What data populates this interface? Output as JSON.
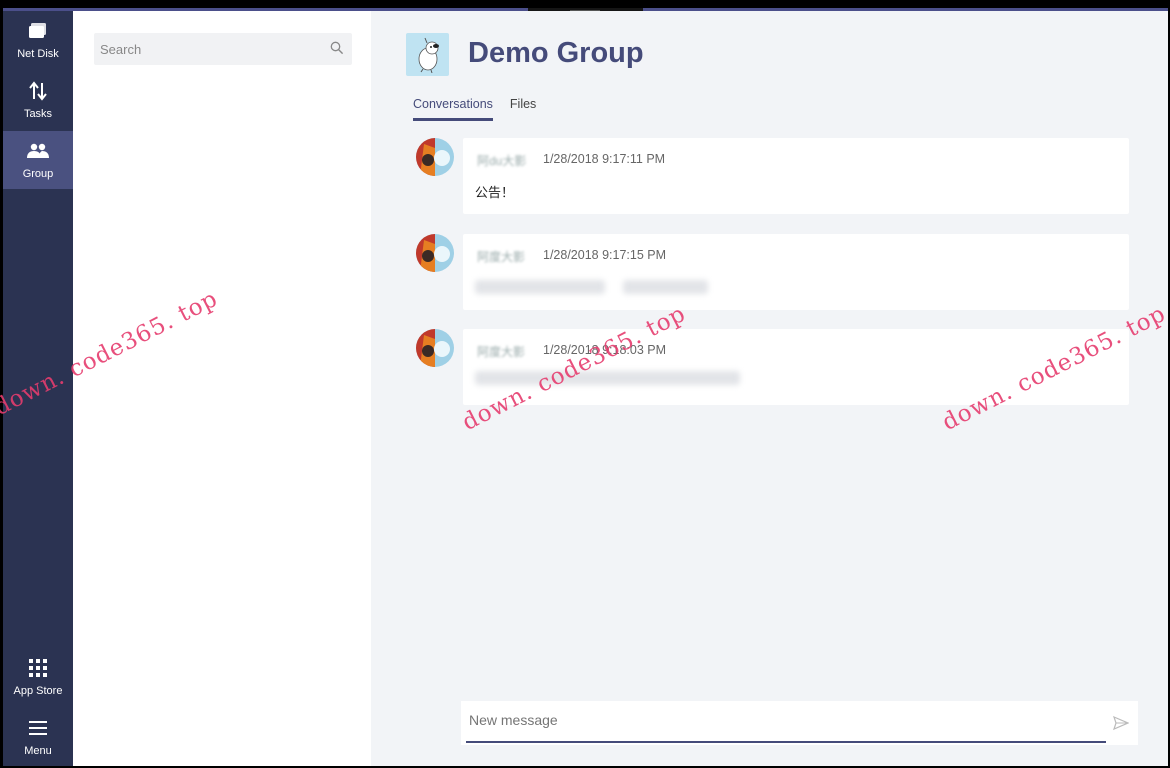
{
  "rail": {
    "items": [
      {
        "label": "Net Disk",
        "icon": "folder-icon"
      },
      {
        "label": "Tasks",
        "icon": "arrows-updown-icon"
      },
      {
        "label": "Group",
        "icon": "people-icon",
        "active": true
      },
      {
        "label": "App Store",
        "icon": "apps-grid-icon"
      },
      {
        "label": "Menu",
        "icon": "hamburger-menu-icon"
      }
    ]
  },
  "search": {
    "placeholder": "Search"
  },
  "group": {
    "title": "Demo Group"
  },
  "tabs": [
    {
      "label": "Conversations",
      "active": true
    },
    {
      "label": "Files",
      "active": false
    }
  ],
  "messages": [
    {
      "sender": "阿du大影",
      "time": "1/28/2018 9:17:11 PM",
      "body": "公告！"
    },
    {
      "sender": "阿度大影",
      "time": "1/28/2018 9:17:15 PM",
      "body": ""
    },
    {
      "sender": "阿度大影",
      "time": "1/28/2018 9:18:03 PM",
      "body": ""
    }
  ],
  "compose": {
    "placeholder": "New message"
  },
  "watermarks": [
    "down. code365. top",
    "down. code365. top",
    "down. code365. top"
  ],
  "colors": {
    "rail": "#2b3352",
    "rail_active": "#4a5180",
    "accent": "#454b7a",
    "watermark": "#e63c6e"
  }
}
